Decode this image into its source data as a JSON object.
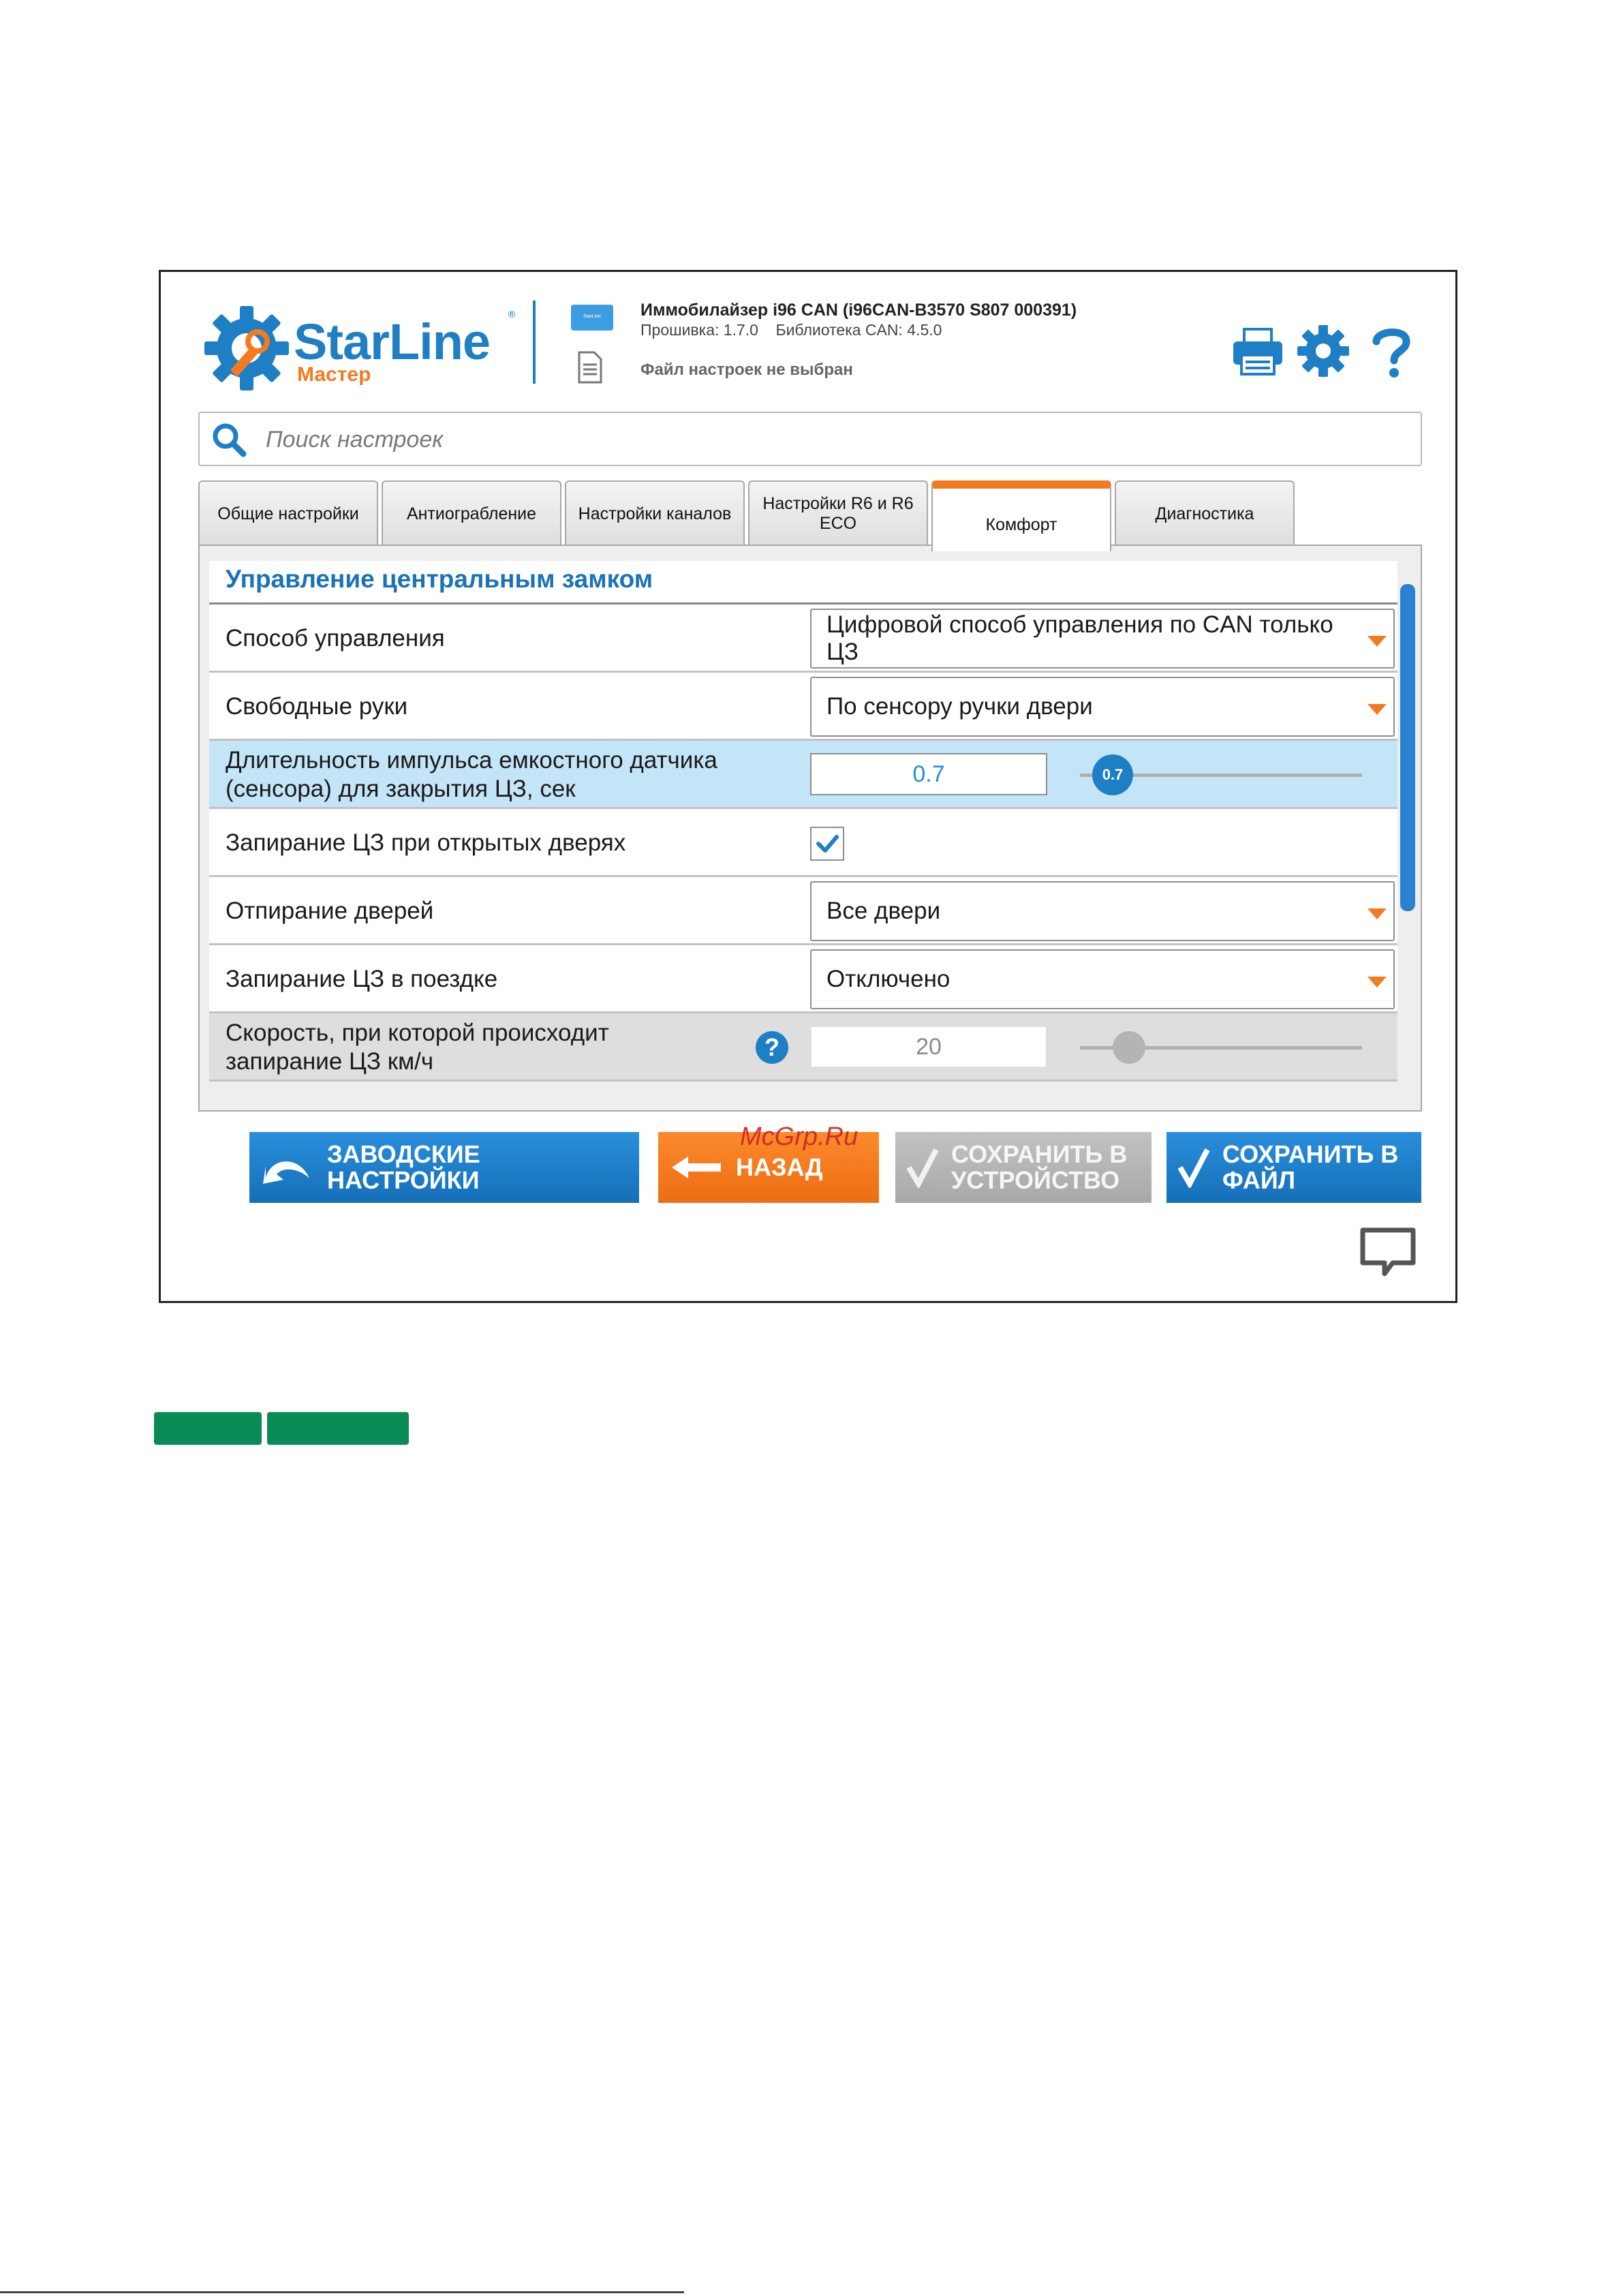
{
  "app": {
    "logo_text": "StarLine",
    "logo_tm": "®",
    "logo_sub": "Мастер",
    "device_badge": "StarLine"
  },
  "device": {
    "title": "Иммобилайзер i96 CAN (i96CAN-B3570 S807 000391)",
    "firmware": "Прошивка: 1.7.0    Библиотека CAN: 4.5.0",
    "file_status": "Файл настроек не выбран"
  },
  "search": {
    "placeholder": "Поиск настроек"
  },
  "tabs": [
    {
      "label": "Общие настройки"
    },
    {
      "label": "Антиограбление"
    },
    {
      "label": "Настройки каналов"
    },
    {
      "label": "Настройки R6 и R6 ECO"
    },
    {
      "label": "Комфорт"
    },
    {
      "label": "Диагностика"
    }
  ],
  "active_tab": "Комфорт",
  "section": {
    "title": "Управление центральным замком"
  },
  "settings": [
    {
      "label": "Способ управления",
      "value": "Цифровой способ управления по CAN только ЦЗ"
    },
    {
      "label": "Свободные руки",
      "value": "По сенсору ручки двери"
    },
    {
      "label": "Длительность импульса емкостного датчика (сенсора) для закрытия ЦЗ, сек",
      "value": "0.7",
      "slider_value": "0.7"
    },
    {
      "label": "Запирание ЦЗ при открытых дверях",
      "checked": true
    },
    {
      "label": "Отпирание дверей",
      "value": "Все двери"
    },
    {
      "label": "Запирание ЦЗ в поездке",
      "value": "Отключено"
    },
    {
      "label": "Скорость, при которой происходит запирание ЦЗ км/ч",
      "value": "20",
      "help": "?"
    }
  ],
  "buttons": {
    "factory": "ЗАВОДСКИЕ НАСТРОЙКИ",
    "back": "НАЗАД",
    "save_device": "СОХРАНИТЬ В УСТРОЙСТВО",
    "save_file": "СОХРАНИТЬ В ФАЙЛ"
  },
  "watermark": "McGrp.Ru",
  "colors": {
    "brand_blue": "#1f7fc4",
    "accent_orange": "#f47a20",
    "highlight_row": "#c4e5f8",
    "green_bar": "#0a8a55"
  },
  "icons": [
    "gear-logo-icon",
    "device-icon",
    "document-icon",
    "printer-icon",
    "settings-gear-icon",
    "help-icon",
    "search-icon",
    "chevron-down-icon",
    "checkmark-icon",
    "undo-arrow-icon",
    "left-arrow-icon",
    "chat-icon"
  ]
}
